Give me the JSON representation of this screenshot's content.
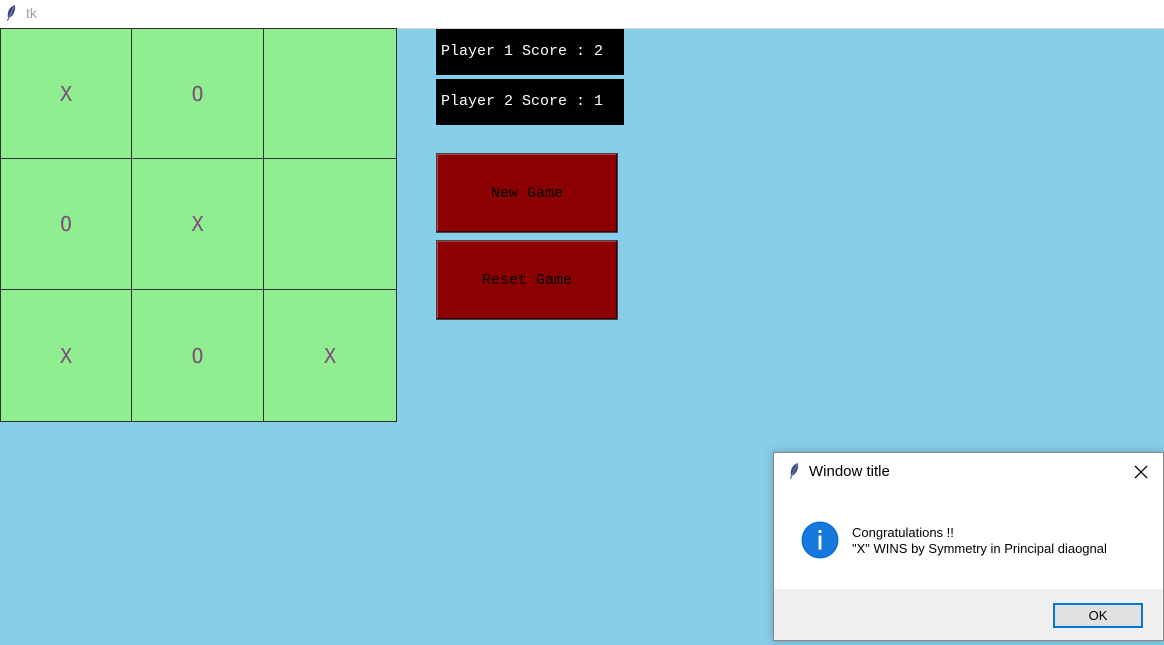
{
  "window": {
    "title": "tk"
  },
  "board": {
    "cells": [
      "X",
      "O",
      "",
      "O",
      "X",
      "",
      "X",
      "O",
      "X"
    ]
  },
  "scores": {
    "player1": "Player 1 Score : 2",
    "player2": "Player 2 Score : 1"
  },
  "buttons": {
    "new_game": "New Game",
    "reset_game": "Reset Game"
  },
  "dialog": {
    "title": "Window title",
    "line1": "Congratulations !!",
    "line2": "\"X\" WINS by Symmetry in Principal diaognal",
    "ok_label": "OK",
    "icon": "info-icon"
  },
  "colors": {
    "background": "#87ceeb",
    "cell": "#90ee90",
    "button": "#8b0000",
    "score_bg": "#000000",
    "mark": "#7a4f7a",
    "accent": "#0078d7"
  }
}
